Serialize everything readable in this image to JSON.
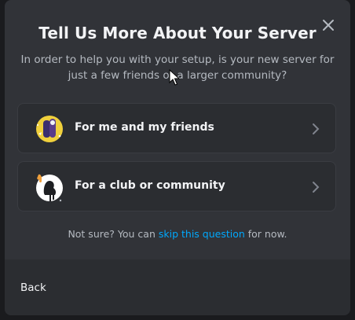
{
  "modal": {
    "title": "Tell Us More About Your Server",
    "subtitle": "In order to help you with your setup, is your new server for just a few friends or a larger community?",
    "close_icon": "close-icon",
    "options": [
      {
        "label": "For me and my friends",
        "icon": "friends-emblem-icon"
      },
      {
        "label": "For a club or community",
        "icon": "community-emblem-icon"
      }
    ],
    "skip": {
      "prefix": "Not sure? You can ",
      "link": "skip this question",
      "suffix": " for now."
    },
    "footer": {
      "back_label": "Back"
    }
  },
  "colors": {
    "accent_link": "#00a8fc",
    "modal_bg": "#313338",
    "option_bg": "#2b2d31"
  }
}
